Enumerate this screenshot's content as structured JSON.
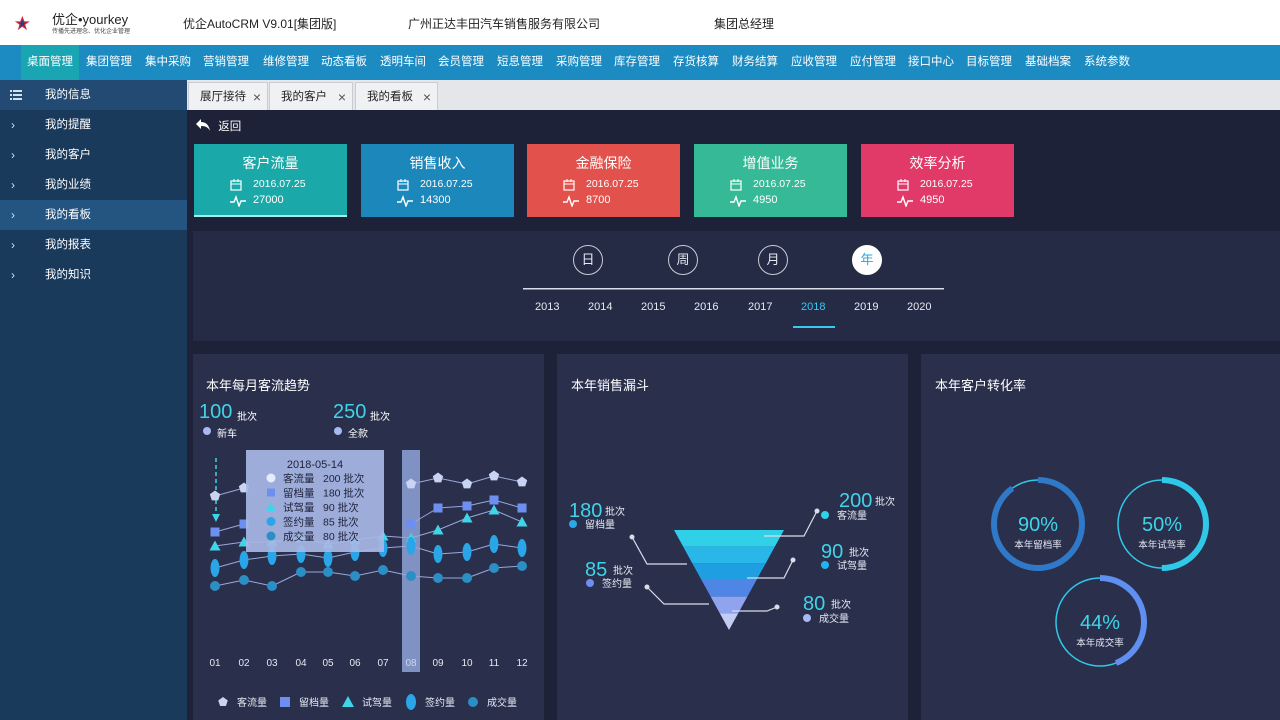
{
  "header": {
    "logo_text": "优企•yourkey",
    "logo_sub": "传播先进理念、优化企业管理",
    "app_title": "优企AutoCRM V9.01[集团版]",
    "company": "广州正达丰田汽车销售服务有限公司",
    "role": "集团总经理"
  },
  "nav": [
    "桌面管理",
    "集团管理",
    "集中采购",
    "营销管理",
    "维修管理",
    "动态看板",
    "透明车间",
    "会员管理",
    "短息管理",
    "采购管理",
    "库存管理",
    "存货核算",
    "财务结算",
    "应收管理",
    "应付管理",
    "接口中心",
    "目标管理",
    "基础档案",
    "系统参数"
  ],
  "sidebar": {
    "head": "我的信息",
    "items": [
      "我的提醒",
      "我的客户",
      "我的业绩",
      "我的看板",
      "我的报表",
      "我的知识"
    ]
  },
  "tabs": [
    "展厅接待",
    "我的客户",
    "我的看板"
  ],
  "back_label": "返回",
  "cards": [
    {
      "title": "客户流量",
      "date": "2016.07.25",
      "value": "27000",
      "color": "#1aa9a8"
    },
    {
      "title": "销售收入",
      "date": "2016.07.25",
      "value": "14300",
      "color": "#1c87bb"
    },
    {
      "title": "金融保险",
      "date": "2016.07.25",
      "value": "8700",
      "color": "#e2514c"
    },
    {
      "title": "增值业务",
      "date": "2016.07.25",
      "value": "4950",
      "color": "#36b996"
    },
    {
      "title": "效率分析",
      "date": "2016.07.25",
      "value": "4950",
      "color": "#e23a68"
    }
  ],
  "periods": [
    "日",
    "周",
    "月",
    "年"
  ],
  "active_period": "年",
  "years": [
    "2013",
    "2014",
    "2015",
    "2016",
    "2017",
    "2018",
    "2019",
    "2020"
  ],
  "active_year": "2018",
  "trend_panel": {
    "title": "本年每月客流趋势",
    "kpi1_value": "100",
    "kpi1_unit": "批次",
    "kpi1_label": "新车",
    "kpi2_value": "250",
    "kpi2_unit": "批次",
    "kpi2_label": "全款",
    "tooltip": {
      "date": "2018-05-14",
      "rows": [
        {
          "name": "客流量",
          "value": "200 批次"
        },
        {
          "name": "留档量",
          "value": "180 批次"
        },
        {
          "name": "试驾量",
          "value": "90 批次"
        },
        {
          "name": "签约量",
          "value": "85 批次"
        },
        {
          "name": "成交量",
          "value": "80 批次"
        }
      ]
    }
  },
  "chart_data": {
    "type": "scatter",
    "x": [
      "01",
      "02",
      "03",
      "04",
      "05",
      "06",
      "07",
      "08",
      "09",
      "10",
      "11",
      "12"
    ],
    "highlight": "08",
    "series": [
      {
        "name": "客流量",
        "marker": "pentagon",
        "color": "#c9d4f2",
        "values": [
          72,
          76,
          null,
          null,
          null,
          null,
          null,
          78,
          81,
          78,
          82,
          79
        ]
      },
      {
        "name": "留档量",
        "marker": "square",
        "color": "#6d8ff0",
        "values": [
          54,
          58,
          null,
          null,
          null,
          null,
          null,
          58,
          66,
          67,
          70,
          66
        ]
      },
      {
        "name": "试驾量",
        "marker": "triangle",
        "color": "#3fd4e8",
        "values": [
          47,
          49,
          49,
          51,
          48,
          50,
          52,
          51,
          55,
          61,
          65,
          59
        ]
      },
      {
        "name": "签约量",
        "marker": "ellipse",
        "color": "#2aa6e8",
        "values": [
          36,
          40,
          42,
          43,
          41,
          44,
          46,
          47,
          43,
          44,
          48,
          46
        ]
      },
      {
        "name": "成交量",
        "marker": "circle",
        "color": "#2b8ec4",
        "values": [
          27,
          30,
          27,
          34,
          34,
          32,
          35,
          32,
          31,
          31,
          36,
          37
        ]
      }
    ],
    "ylim": [
      0,
      100
    ]
  },
  "funnel_panel": {
    "title": "本年销售漏斗",
    "labels": [
      {
        "value": "180",
        "unit": "批次",
        "name": "留档量",
        "color": "#2ba8e6"
      },
      {
        "value": "85",
        "unit": "批次",
        "name": "签约量",
        "color": "#6d8ff0"
      },
      {
        "value": "200",
        "unit": "批次",
        "name": "客流量",
        "color": "#2fd0e8"
      },
      {
        "value": "90",
        "unit": "批次",
        "name": "试驾量",
        "color": "#23b2f0"
      },
      {
        "value": "80",
        "unit": "批次",
        "name": "成交量",
        "color": "#a9b8f2"
      }
    ],
    "layers": [
      "#2fd0e8",
      "#29b6e8",
      "#1f9fe2",
      "#4f86e6",
      "#8fa3ee",
      "#c3cdf3"
    ]
  },
  "conversion_panel": {
    "title": "本年客户转化率",
    "gauges": [
      {
        "percent": 90,
        "label": "本年留档率",
        "value": "90%",
        "color": "#2f79c8"
      },
      {
        "percent": 50,
        "label": "本年试驾率",
        "value": "50%",
        "color": "#30c8e8"
      },
      {
        "percent": 44,
        "label": "本年成交率",
        "value": "44%",
        "color": "#5f8ff0"
      }
    ]
  }
}
